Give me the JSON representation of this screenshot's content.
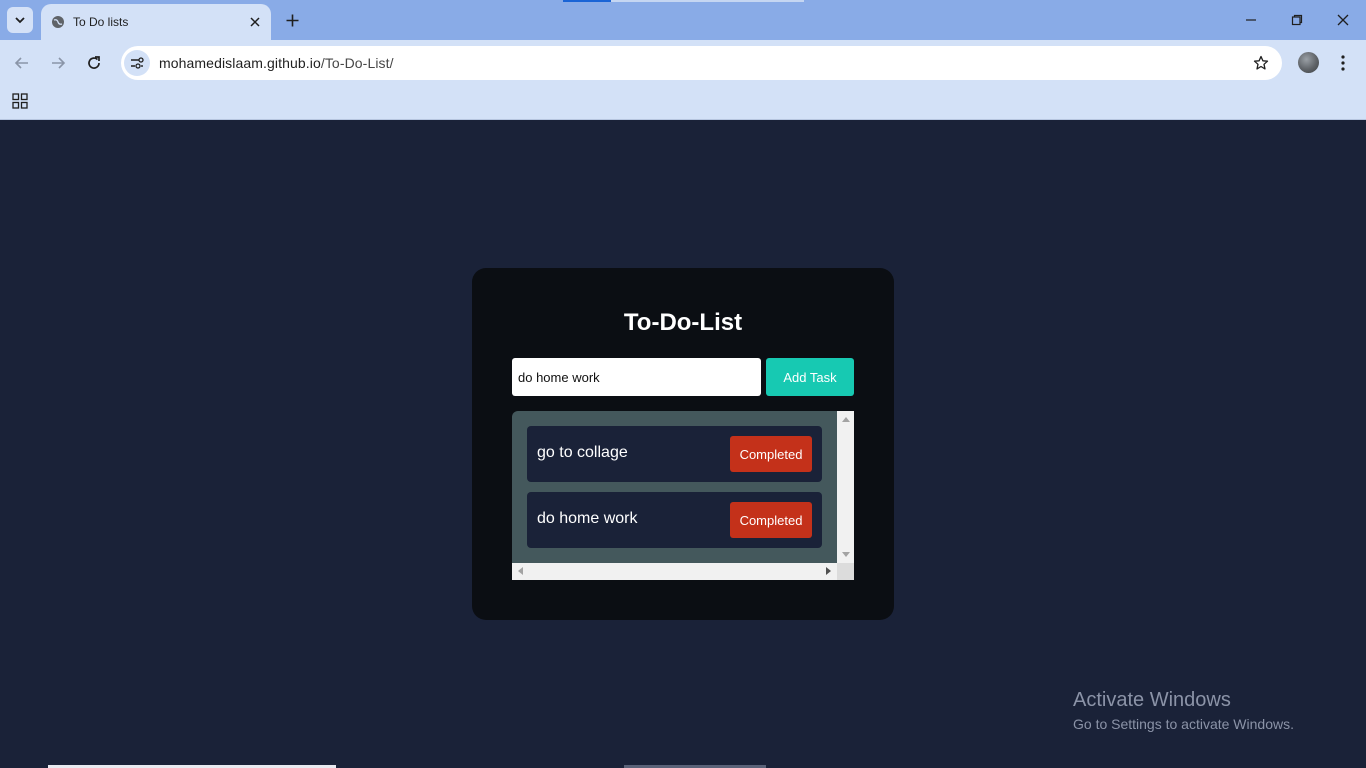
{
  "browser": {
    "tab_title": "To Do lists",
    "url_host": "mohamedislaam.github.io",
    "url_path": "/To-Do-List/"
  },
  "app": {
    "title": "To-Do-List",
    "input_value": "do home work",
    "add_button": "Add Task",
    "tasks": [
      {
        "text": "go to collage",
        "action": "Completed"
      },
      {
        "text": "do home work",
        "action": "Completed"
      }
    ]
  },
  "watermark": {
    "title": "Activate Windows",
    "subtitle": "Go to Settings to activate Windows."
  },
  "colors": {
    "page_background": "#1a2238",
    "card_background": "#0b0e13",
    "accent": "#17c9b2",
    "completed_button": "#c4311a",
    "list_background": "#44585c"
  }
}
